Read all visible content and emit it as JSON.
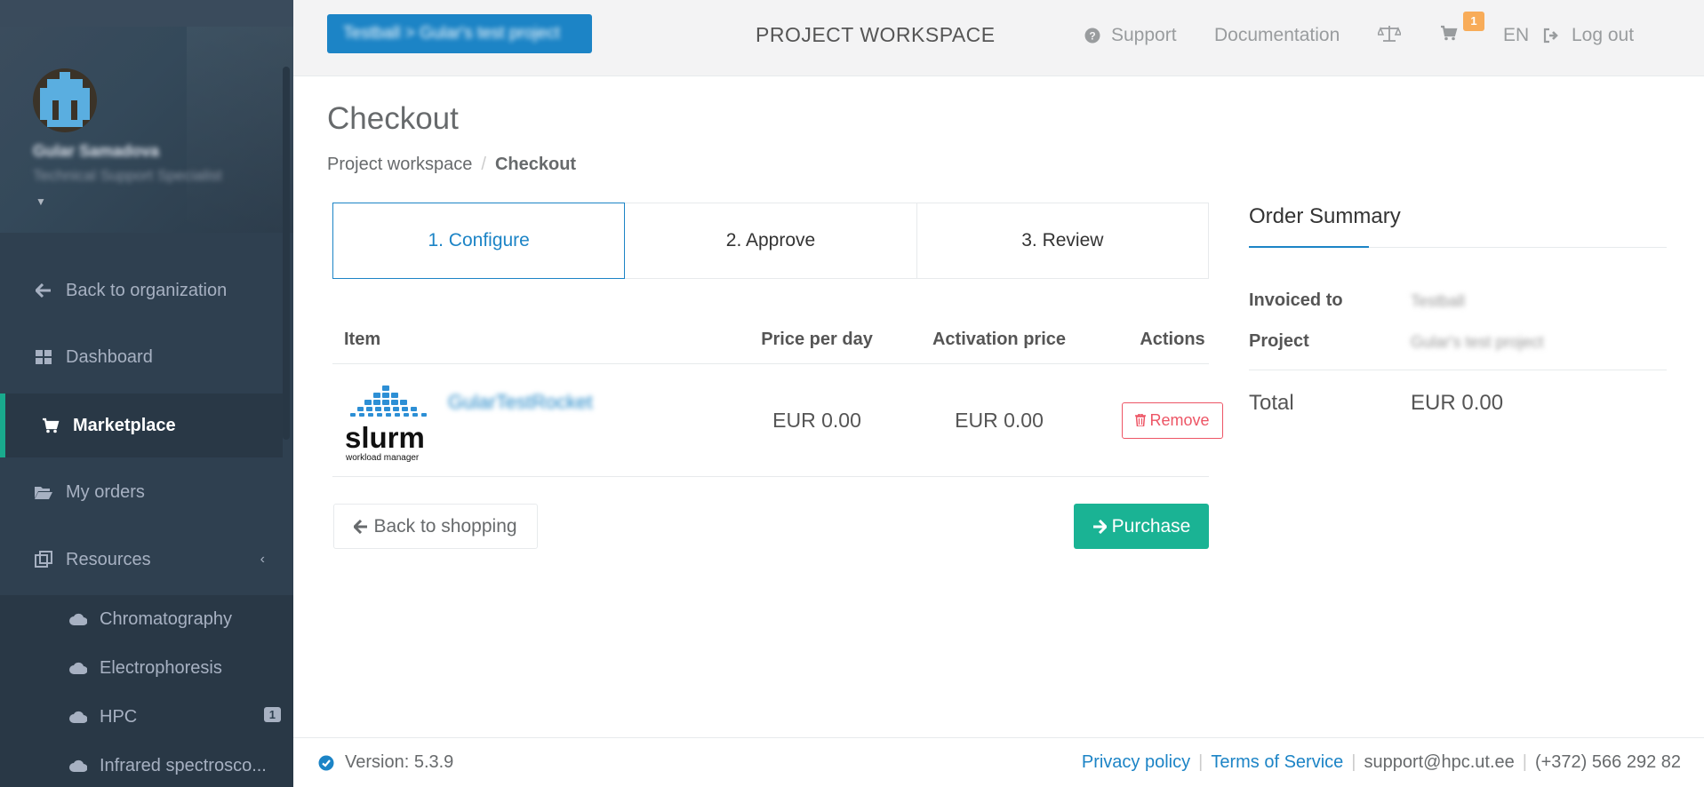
{
  "sidebar": {
    "user": {
      "name": "Gular Samadova",
      "role": "Technical Support Specialist"
    },
    "nav": [
      {
        "label": "Back to organization",
        "icon": "arrow-left-icon"
      },
      {
        "label": "Dashboard",
        "icon": "dashboard-icon"
      },
      {
        "label": "Marketplace",
        "icon": "shopping-cart-icon",
        "active": true
      },
      {
        "label": "My orders",
        "icon": "folder-open-icon"
      },
      {
        "label": "Resources",
        "icon": "resources-icon"
      }
    ],
    "resources": [
      {
        "label": "Chromatography",
        "icon": "cloud-icon"
      },
      {
        "label": "Electrophoresis",
        "icon": "cloud-icon"
      },
      {
        "label": "HPC",
        "icon": "cloud-icon",
        "badge": "1"
      },
      {
        "label": "Infrared spectrosco...",
        "icon": "cloud-icon"
      }
    ]
  },
  "header": {
    "project_selector": "Testball > Gular's test project",
    "title": "PROJECT WORKSPACE",
    "support": "Support",
    "documentation": "Documentation",
    "cart_count": "1",
    "language": "EN",
    "logout": "Log out"
  },
  "page": {
    "title": "Checkout",
    "breadcrumb": {
      "parent": "Project workspace",
      "current": "Checkout"
    }
  },
  "steps": [
    "1. Configure",
    "2. Approve",
    "3. Review"
  ],
  "table": {
    "headers": {
      "item": "Item",
      "price_per_day": "Price per day",
      "activation_price": "Activation price",
      "actions": "Actions"
    },
    "rows": [
      {
        "name": "GularTestRocket",
        "logo_text": "slurm",
        "logo_sub": "workload manager",
        "price_per_day": "EUR 0.00",
        "activation_price": "EUR 0.00",
        "action": "Remove"
      }
    ]
  },
  "buttons": {
    "back": "Back to shopping",
    "purchase": "Purchase"
  },
  "summary": {
    "title": "Order Summary",
    "invoiced_label": "Invoiced to",
    "invoiced_value": "Testball",
    "project_label": "Project",
    "project_value": "Gular's test project",
    "total_label": "Total",
    "total_value": "EUR 0.00"
  },
  "footer": {
    "version": "Version: 5.3.9",
    "privacy": "Privacy policy",
    "terms": "Terms of Service",
    "email": "support@hpc.ut.ee",
    "phone": "(+372) 566 292 82"
  },
  "colors": {
    "sidebar": "#2f4050",
    "accent": "#1ab394",
    "primary": "#1c84c6",
    "danger": "#ed5565",
    "warning": "#f8ac59"
  }
}
